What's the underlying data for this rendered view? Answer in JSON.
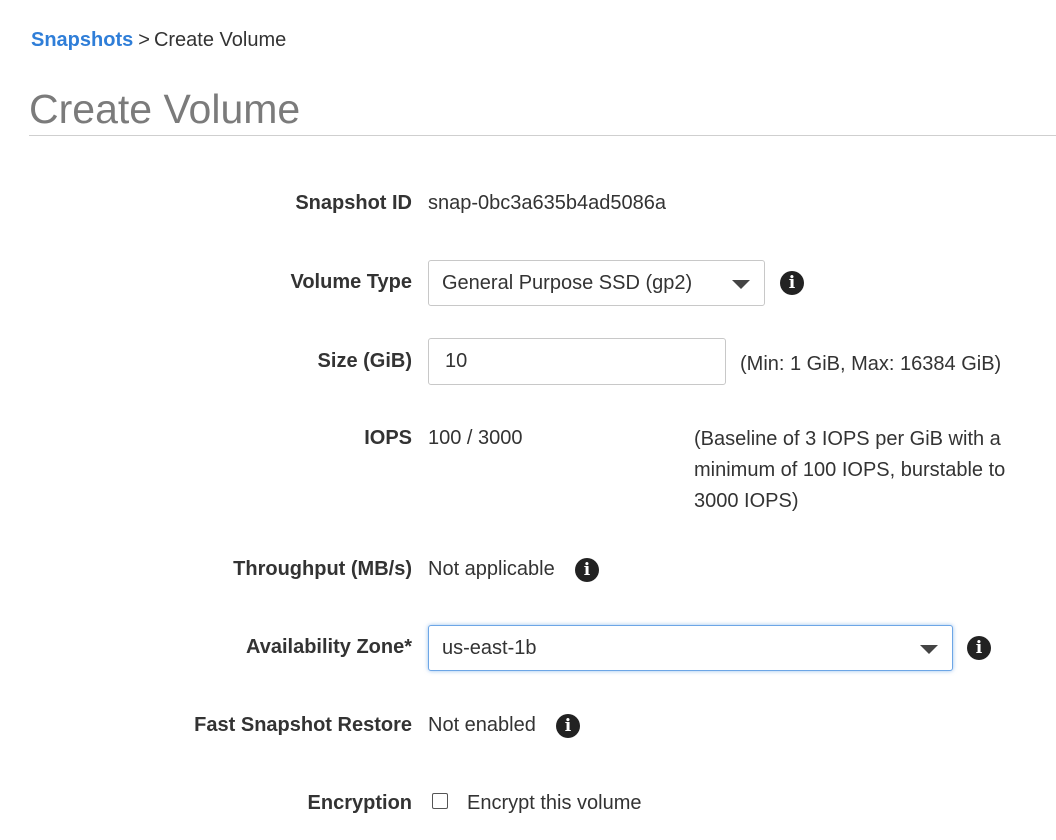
{
  "breadcrumb": {
    "parent": "Snapshots",
    "separator": ">",
    "current": "Create Volume"
  },
  "page_title": "Create Volume",
  "form": {
    "snapshot_id": {
      "label": "Snapshot ID",
      "value": "snap-0bc3a635b4ad5086a"
    },
    "volume_type": {
      "label": "Volume Type",
      "selected": "General Purpose SSD (gp2)",
      "icon": "info-icon"
    },
    "size": {
      "label": "Size (GiB)",
      "value": "10",
      "hint": "(Min: 1 GiB, Max: 16384 GiB)"
    },
    "iops": {
      "label": "IOPS",
      "value": "100 / 3000",
      "hint_lines": [
        "(Baseline of 3 IOPS per GiB with a",
        "minimum of 100 IOPS, burstable to",
        "3000 IOPS)"
      ]
    },
    "throughput": {
      "label": "Throughput (MB/s)",
      "value": "Not applicable",
      "icon": "info-icon"
    },
    "availability_zone": {
      "label": "Availability Zone*",
      "selected": "us-east-1b",
      "icon": "info-icon"
    },
    "fast_snapshot_restore": {
      "label": "Fast Snapshot Restore",
      "value": "Not enabled",
      "icon": "info-icon"
    },
    "encryption": {
      "label": "Encryption",
      "checkbox_label": "Encrypt this volume",
      "checked": false
    }
  },
  "colors": {
    "link": "#2f7ed8",
    "title": "#7b7b7b",
    "focus_border": "#6da6e6"
  }
}
